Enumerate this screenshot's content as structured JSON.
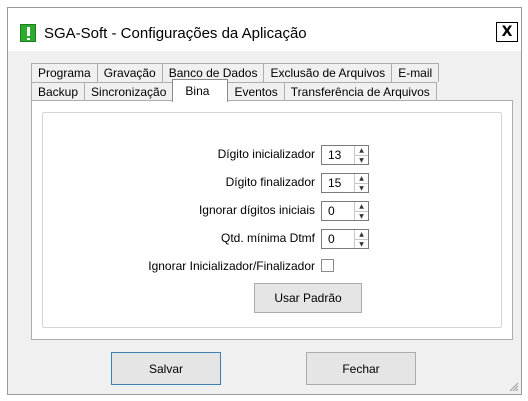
{
  "window": {
    "title": "SGA-Soft - Configurações da Aplicação",
    "close_glyph": "X"
  },
  "tabs": {
    "row1": [
      "Programa",
      "Gravação",
      "Banco de Dados",
      "Exclusão de Arquivos",
      "E-mail"
    ],
    "row2": [
      "Backup",
      "Sincronização",
      "Bina",
      "Eventos",
      "Transferência de Arquivos"
    ],
    "active": "Bina"
  },
  "bina": {
    "digito_inicializador": {
      "label": "Dígito inicializador",
      "value": "13"
    },
    "digito_finalizador": {
      "label": "Dígito finalizador",
      "value": "15"
    },
    "ignorar_digitos_iniciais": {
      "label": "Ignorar dígitos iniciais",
      "value": "0"
    },
    "qtd_minima_dtmf": {
      "label": "Qtd. mínima Dtmf",
      "value": "0"
    },
    "ignorar_inicializador_finalizador": {
      "label": "Ignorar Inicializador/Finalizador",
      "checked": false
    },
    "usar_padrao_label": "Usar Padrão"
  },
  "footer": {
    "salvar_label": "Salvar",
    "fechar_label": "Fechar"
  },
  "colors": {
    "app_icon": "#2eaa2e",
    "default_button_border": "#3c7fb1"
  },
  "icons": {
    "app": "warning-app-icon",
    "spin_up": "▲",
    "spin_down": "▼"
  }
}
